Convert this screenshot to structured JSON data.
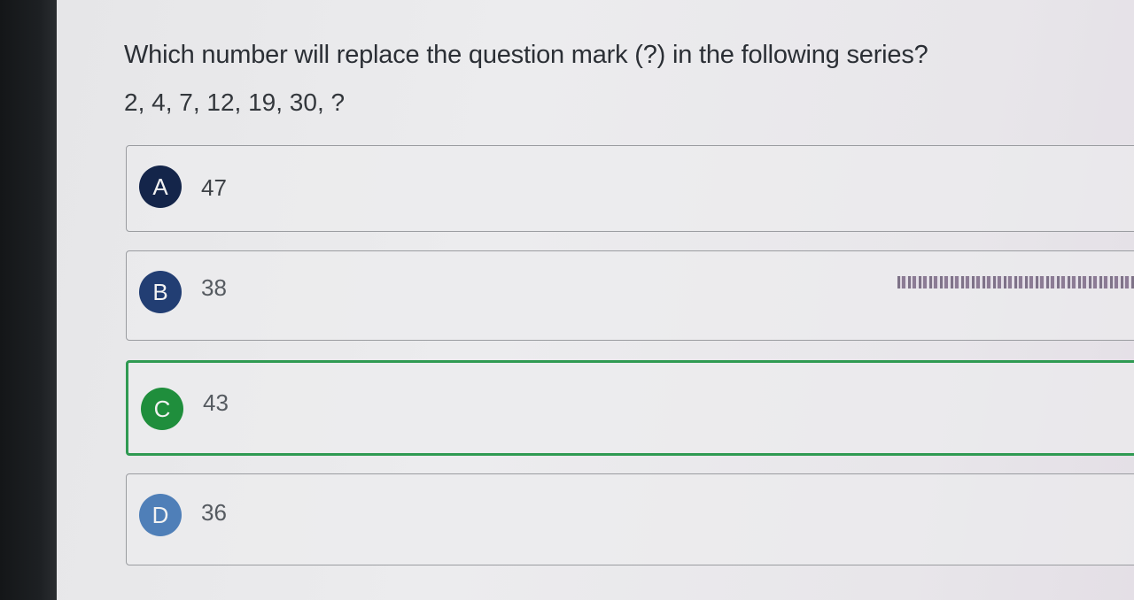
{
  "question": {
    "text": "Which number will replace the question mark (?) in the following series?",
    "series": "2, 4, 7, 12, 19, 30, ?"
  },
  "options": [
    {
      "letter": "A",
      "value": "47",
      "state": "default",
      "badge_color": "#14254a"
    },
    {
      "letter": "B",
      "value": "38",
      "state": "default",
      "badge_color": "#223e73"
    },
    {
      "letter": "C",
      "value": "43",
      "state": "correct",
      "badge_color": "#1f8e3c"
    },
    {
      "letter": "D",
      "value": "36",
      "state": "default",
      "badge_color": "#4f7fb8"
    }
  ],
  "colors": {
    "correct_border": "#2f9a52",
    "default_border": "#9a9ca0"
  }
}
